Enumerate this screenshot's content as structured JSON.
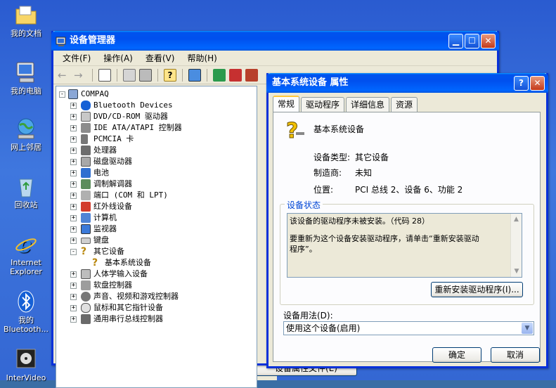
{
  "desktop": {
    "icons": [
      {
        "label": "我的文档"
      },
      {
        "label": "我的电脑"
      },
      {
        "label": "网上邻居"
      },
      {
        "label": "回收站"
      },
      {
        "label": "Internet Explorer"
      },
      {
        "label": "我的 Bluetooth..."
      },
      {
        "label": "InterVideo"
      }
    ]
  },
  "device_manager": {
    "title": "设备管理器",
    "menu": [
      "文件(F)",
      "操作(A)",
      "查看(V)",
      "帮助(H)"
    ],
    "tree": [
      {
        "label": "COMPAQ",
        "exp": "-"
      },
      {
        "label": "Bluetooth Devices",
        "exp": "+"
      },
      {
        "label": "DVD/CD-ROM 驱动器",
        "exp": "+"
      },
      {
        "label": "IDE ATA/ATAPI 控制器",
        "exp": "+"
      },
      {
        "label": "PCMCIA 卡",
        "exp": "+"
      },
      {
        "label": "处理器",
        "exp": "+"
      },
      {
        "label": "磁盘驱动器",
        "exp": "+"
      },
      {
        "label": "电池",
        "exp": "+"
      },
      {
        "label": "调制解调器",
        "exp": "+"
      },
      {
        "label": "端口 (COM 和 LPT)",
        "exp": "+"
      },
      {
        "label": "红外线设备",
        "exp": "+"
      },
      {
        "label": "计算机",
        "exp": "+"
      },
      {
        "label": "监视器",
        "exp": "+"
      },
      {
        "label": "键盘",
        "exp": "+"
      },
      {
        "label": "其它设备",
        "exp": "-"
      },
      {
        "label": "基本系统设备",
        "exp": ""
      },
      {
        "label": "人体学输入设备",
        "exp": "+"
      },
      {
        "label": "软盘控制器",
        "exp": "+"
      },
      {
        "label": "声音、视频和游戏控制器",
        "exp": "+"
      },
      {
        "label": "鼠标和其它指针设备",
        "exp": "+"
      },
      {
        "label": "通用串行总线控制器",
        "exp": "+"
      }
    ]
  },
  "properties": {
    "title": "基本系统设备 属性",
    "help": "?",
    "close": "✕",
    "tabs": [
      "常规",
      "驱动程序",
      "详细信息",
      "资源"
    ],
    "device_name": "基本系统设备",
    "type_label": "设备类型:",
    "type_value": "其它设备",
    "maker_label": "制造商:",
    "maker_value": "未知",
    "location_label": "位置:",
    "location_value": "PCI 总线 2、设备 6、功能 2",
    "status_legend": "设备状态",
    "status_line1": "该设备的驱动程序未被安装。（代码 28）",
    "status_line2": "要重新为这个设备安装驱动程序，请单击“重新安装驱动",
    "status_line3": "程序”。",
    "reinstall_button": "重新安装驱动程序(I)...",
    "usage_label": "设备用法(D):",
    "usage_value": "使用这个设备(启用)",
    "ok": "确定",
    "cancel": "取消"
  },
  "behind_button": "设备属性文件(E)",
  "colors": {
    "title_blue": "#0053ee",
    "window_bg": "#ece9d8",
    "legend_blue": "#0046d5"
  }
}
